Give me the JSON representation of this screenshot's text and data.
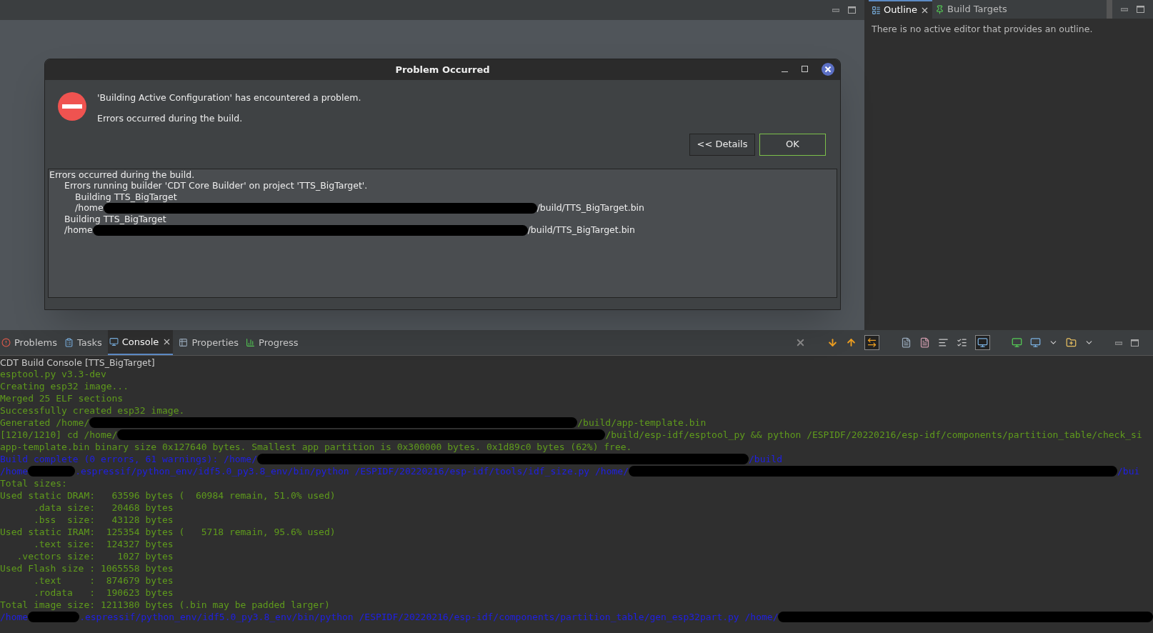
{
  "outline_view": {
    "tabs": [
      {
        "label": "Outline",
        "selected": true,
        "closable": true
      },
      {
        "label": "Build Targets",
        "selected": false,
        "closable": false
      }
    ],
    "message": "There is no active editor that provides an outline."
  },
  "dialog": {
    "title": "Problem Occurred",
    "message": "'Building Active Configuration' has encountered a problem.",
    "detail_message": "Errors occurred during the build.",
    "buttons": [
      {
        "label": "<< Details",
        "default": false
      },
      {
        "label": "OK",
        "default": true
      }
    ],
    "details": [
      {
        "parts": [
          {
            "kind": "text",
            "text": "Errors occurred during the build."
          }
        ],
        "children": [
          {
            "parts": [
              {
                "kind": "text",
                "text": "Errors running builder 'CDT Core Builder' on project 'TTS_BigTarget'."
              }
            ],
            "children": [
              {
                "parts": [
                  {
                    "kind": "text",
                    "text": "Building TTS_BigTarget"
                  }
                ]
              },
              {
                "parts": [
                  {
                    "kind": "text",
                    "text": "/home"
                  },
                  {
                    "kind": "redacted"
                  },
                  {
                    "kind": "text",
                    "text": "/build/TTS_BigTarget.bin"
                  }
                ]
              }
            ]
          },
          {
            "parts": [
              {
                "kind": "text",
                "text": "Building TTS_BigTarget"
              }
            ]
          },
          {
            "parts": [
              {
                "kind": "text",
                "text": "/home"
              },
              {
                "kind": "redacted"
              },
              {
                "kind": "text",
                "text": "/build/TTS_BigTarget.bin"
              }
            ]
          }
        ]
      }
    ]
  },
  "bottom_panel": {
    "tabs": [
      {
        "label": "Problems",
        "selected": false,
        "closable": false
      },
      {
        "label": "Tasks",
        "selected": false,
        "closable": false
      },
      {
        "label": "Console",
        "selected": true,
        "closable": true
      },
      {
        "label": "Properties",
        "selected": false,
        "closable": false
      },
      {
        "label": "Progress",
        "selected": false,
        "closable": false
      }
    ],
    "console_title": "CDT Build Console [TTS_BigTarget]",
    "lines": [
      {
        "kind": "output",
        "parts": [
          {
            "kind": "text",
            "text": "esptool.py v3.3-dev"
          }
        ]
      },
      {
        "kind": "output",
        "parts": [
          {
            "kind": "text",
            "text": "Creating esp32 image..."
          }
        ]
      },
      {
        "kind": "output",
        "parts": [
          {
            "kind": "text",
            "text": "Merged 25 ELF sections"
          }
        ]
      },
      {
        "kind": "output",
        "parts": [
          {
            "kind": "text",
            "text": "Successfully created esp32 image."
          }
        ]
      },
      {
        "kind": "output",
        "parts": [
          {
            "kind": "text",
            "text": "Generated /home/"
          },
          {
            "kind": "redacted"
          },
          {
            "kind": "text",
            "text": "/build/app-template.bin"
          }
        ]
      },
      {
        "kind": "output",
        "parts": [
          {
            "kind": "text",
            "text": "[1210/1210] cd /home/"
          },
          {
            "kind": "redacted"
          },
          {
            "kind": "text",
            "text": "/build/esp-idf/esptool_py && python /ESPIDF/20220216/esp-idf/components/partition_table/check_si"
          }
        ]
      },
      {
        "kind": "output",
        "parts": [
          {
            "kind": "text",
            "text": "app-template.bin binary size 0x127640 bytes. Smallest app partition is 0x300000 bytes. 0x1d89c0 bytes (62%) free."
          }
        ]
      },
      {
        "kind": "info",
        "parts": [
          {
            "kind": "text",
            "text": "Build complete (0 errors, 61 warnings): /home/"
          },
          {
            "kind": "redacted"
          },
          {
            "kind": "text",
            "text": "/build"
          }
        ]
      },
      {
        "kind": "info",
        "parts": [
          {
            "kind": "text",
            "text": "/home"
          },
          {
            "kind": "redacted"
          },
          {
            "kind": "text",
            "text": ".espressif/python_env/idf5.0_py3.8_env/bin/python /ESPIDF/20220216/esp-idf/tools/idf_size.py /home/"
          },
          {
            "kind": "redacted"
          },
          {
            "kind": "text",
            "text": "/bui"
          }
        ]
      },
      {
        "kind": "output",
        "parts": [
          {
            "kind": "text",
            "text": "Total sizes:"
          }
        ]
      },
      {
        "kind": "output",
        "parts": [
          {
            "kind": "text",
            "text": "Used static DRAM:   63596 bytes (  60984 remain, 51.0% used)"
          }
        ]
      },
      {
        "kind": "output",
        "parts": [
          {
            "kind": "text",
            "text": "      .data size:   20468 bytes"
          }
        ]
      },
      {
        "kind": "output",
        "parts": [
          {
            "kind": "text",
            "text": "      .bss  size:   43128 bytes"
          }
        ]
      },
      {
        "kind": "output",
        "parts": [
          {
            "kind": "text",
            "text": "Used static IRAM:  125354 bytes (   5718 remain, 95.6% used)"
          }
        ]
      },
      {
        "kind": "output",
        "parts": [
          {
            "kind": "text",
            "text": "      .text size:  124327 bytes"
          }
        ]
      },
      {
        "kind": "output",
        "parts": [
          {
            "kind": "text",
            "text": "   .vectors size:    1027 bytes"
          }
        ]
      },
      {
        "kind": "output",
        "parts": [
          {
            "kind": "text",
            "text": "Used Flash size : 1065558 bytes"
          }
        ]
      },
      {
        "kind": "output",
        "parts": [
          {
            "kind": "text",
            "text": "      .text     :  874679 bytes"
          }
        ]
      },
      {
        "kind": "output",
        "parts": [
          {
            "kind": "text",
            "text": "      .rodata   :  190623 bytes"
          }
        ]
      },
      {
        "kind": "output",
        "parts": [
          {
            "kind": "text",
            "text": "Total image size: 1211380 bytes (.bin may be padded larger)"
          }
        ]
      },
      {
        "kind": "info",
        "parts": [
          {
            "kind": "text",
            "text": "/home"
          },
          {
            "kind": "redacted"
          },
          {
            "kind": "text",
            "text": ".espressif/python_env/idf5.0_py3.8_env/bin/python /ESPIDF/20220216/esp-idf/components/partition_table/gen_esp32part.py /home/"
          },
          {
            "kind": "redacted"
          }
        ]
      }
    ]
  }
}
